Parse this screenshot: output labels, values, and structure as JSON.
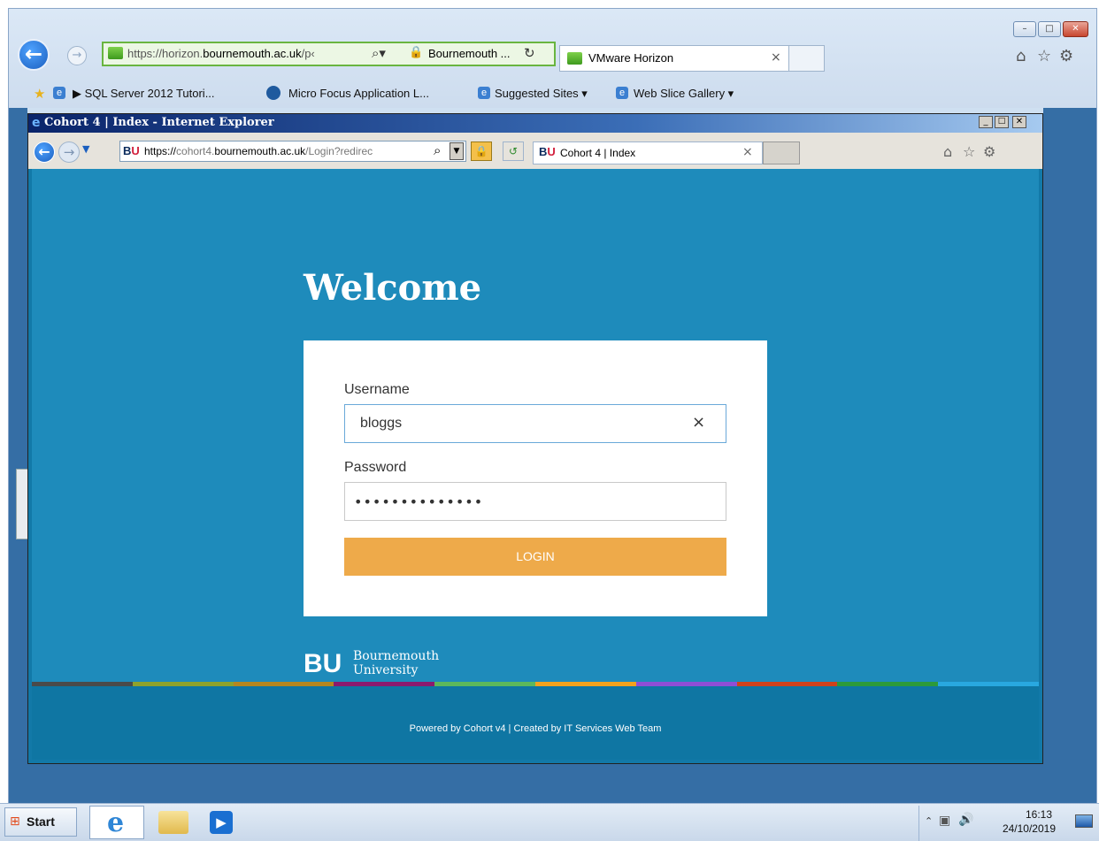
{
  "outer_browser": {
    "address": "https://horizon.bournemouth.ac.uk/p‹",
    "address_url_prefix": "https://horizon.",
    "address_url_domain": "bournemouth.ac.uk",
    "address_url_rest": "/p‹",
    "site_identity": "Bournemouth ...",
    "tab_title": "VMware Horizon",
    "window_controls": {
      "minimize": "–",
      "maximize": "□",
      "close": "✕"
    },
    "favorites": [
      {
        "label": "▶ SQL Server 2012 Tutori..."
      },
      {
        "label": "Micro Focus Application L..."
      },
      {
        "label": "Suggested Sites ▾"
      },
      {
        "label": "Web Slice Gallery ▾"
      }
    ]
  },
  "inner_browser": {
    "window_title": "Cohort 4 | Index - Internet Explorer",
    "address_prefix": "https://",
    "address_domain_a": "cohort4.",
    "address_domain_b": "bournemouth.ac.uk",
    "address_rest": "/Login?redirec",
    "tab_title": "Cohort 4 | Index",
    "tab_logo": "BU"
  },
  "page": {
    "heading": "Welcome",
    "username_label": "Username",
    "username_value": "bloggs",
    "password_label": "Password",
    "password_value": "••••••••••••••",
    "login_button": "LOGIN",
    "logo_mark": "BU",
    "logo_line1": "Bournemouth",
    "logo_line2": "University",
    "footer_text": "Powered by Cohort v4 | Created by IT Services Web Team",
    "stripe_colors": [
      "#4a4a4a",
      "#8ea22b",
      "#b5861f",
      "#8b1a6e",
      "#5cb85c",
      "#f3a21c",
      "#8f4ed6",
      "#d0421b",
      "#2c9a3a",
      "#29a8e0"
    ]
  },
  "taskbar": {
    "start_label": "Start",
    "time": "16:13",
    "date": "24/10/2019"
  },
  "colors": {
    "accent": "#eeaa4a",
    "page_bg": "#1e8bbb"
  }
}
